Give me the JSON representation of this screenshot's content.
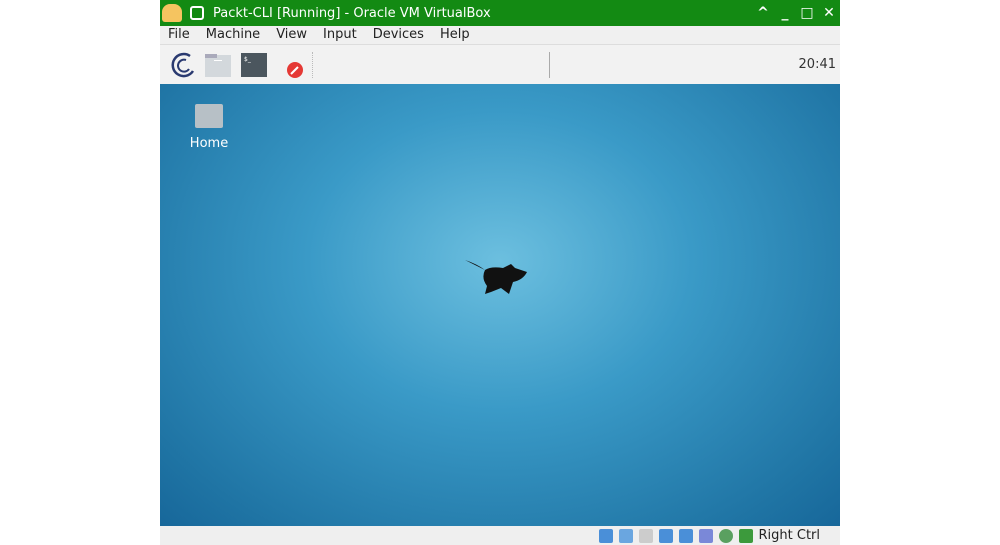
{
  "window": {
    "title": "Packt-CLI [Running] - Oracle VM VirtualBox"
  },
  "menu": [
    "File",
    "Machine",
    "View",
    "Input",
    "Devices",
    "Help"
  ],
  "panel": {
    "clock": "20:41"
  },
  "desktop": {
    "home_label": "Home"
  },
  "status": {
    "host_key": "Right Ctrl",
    "icons": [
      "hard-disk-icon",
      "optical-drive-icon",
      "audio-icon",
      "network-icon",
      "shared-folders-icon",
      "usb-icon",
      "display-icon",
      "mouse-integration-icon"
    ]
  }
}
